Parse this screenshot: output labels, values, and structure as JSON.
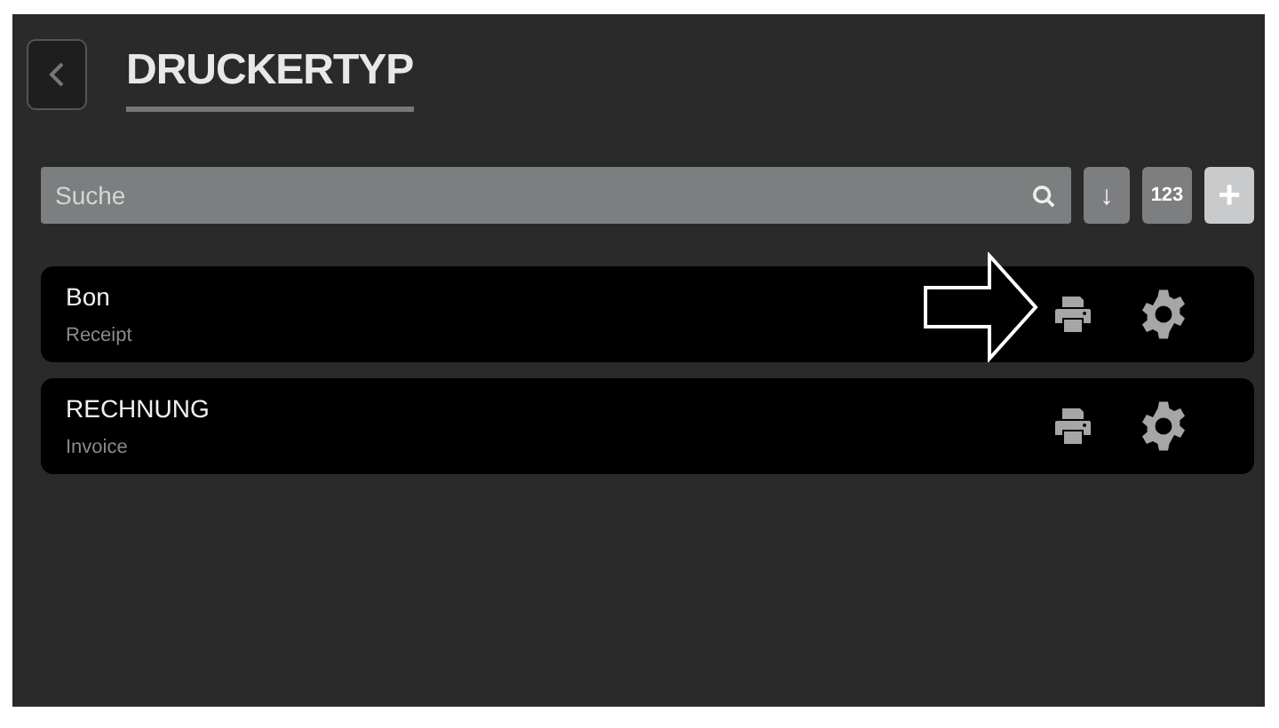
{
  "header": {
    "title": "DRUCKERTYP"
  },
  "search": {
    "placeholder": "Suche"
  },
  "toolbar": {
    "sort_label": "↓",
    "numeric_label": "123",
    "add_label": "+"
  },
  "printer_types": [
    {
      "name": "Bon",
      "subtitle": "Receipt",
      "highlighted_by_arrow": true
    },
    {
      "name": "RECHNUNG",
      "subtitle": "Invoice",
      "highlighted_by_arrow": false
    }
  ]
}
